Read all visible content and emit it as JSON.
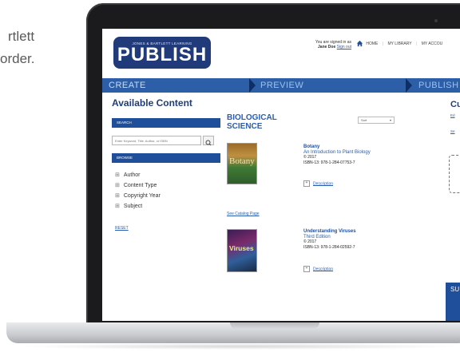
{
  "promo": {
    "line1": "rtlett",
    "line2": "order."
  },
  "header": {
    "logo_top": "JONES & BARTLETT LEARNING",
    "logo_main": "PUBLISH",
    "signed_in_text": "You are signed in as",
    "user_name": "Jane Doe",
    "sign_out": "Sign out",
    "nav": [
      "HOME",
      "MY LIBRARY",
      "MY ACCOU"
    ]
  },
  "steps": [
    "CREATE",
    "PREVIEW",
    "PUBLISH"
  ],
  "sidebar": {
    "title": "Available Content",
    "search_head": "SEARCH",
    "search_placeholder": "Enter Keyword, Title, Author, or ISBN",
    "browse_head": "BROWSE",
    "browse_items": [
      "Author",
      "Content Type",
      "Copyright Year",
      "Subject"
    ],
    "reset": "RESET"
  },
  "catalog": {
    "title_line1": "BIOLOGICAL",
    "title_line2": "SCIENCE",
    "sort_label": "Sort",
    "see_catalog": "See Catalog Page",
    "books": [
      {
        "cover_text": "Botany",
        "title": "Botany",
        "subtitle": "An Introduction to Plant Biology",
        "year": "© 2017",
        "isbn": "ISBN-13: 978-1-284-07753-7",
        "description": "Description"
      },
      {
        "cover_text": "Viruses",
        "title": "Understanding Viruses",
        "subtitle": "Third Edition",
        "year": "© 2017",
        "isbn": "ISBN-13: 978-1-284-02592-7",
        "description": "Description"
      }
    ]
  },
  "right_column": {
    "title": "Cu",
    "link1": "Ed",
    "link2": "Se",
    "box_title": "SU"
  },
  "colors": {
    "brand_blue": "#203a7a",
    "step_bar": "#2d5fa8",
    "link": "#2a5db0"
  }
}
